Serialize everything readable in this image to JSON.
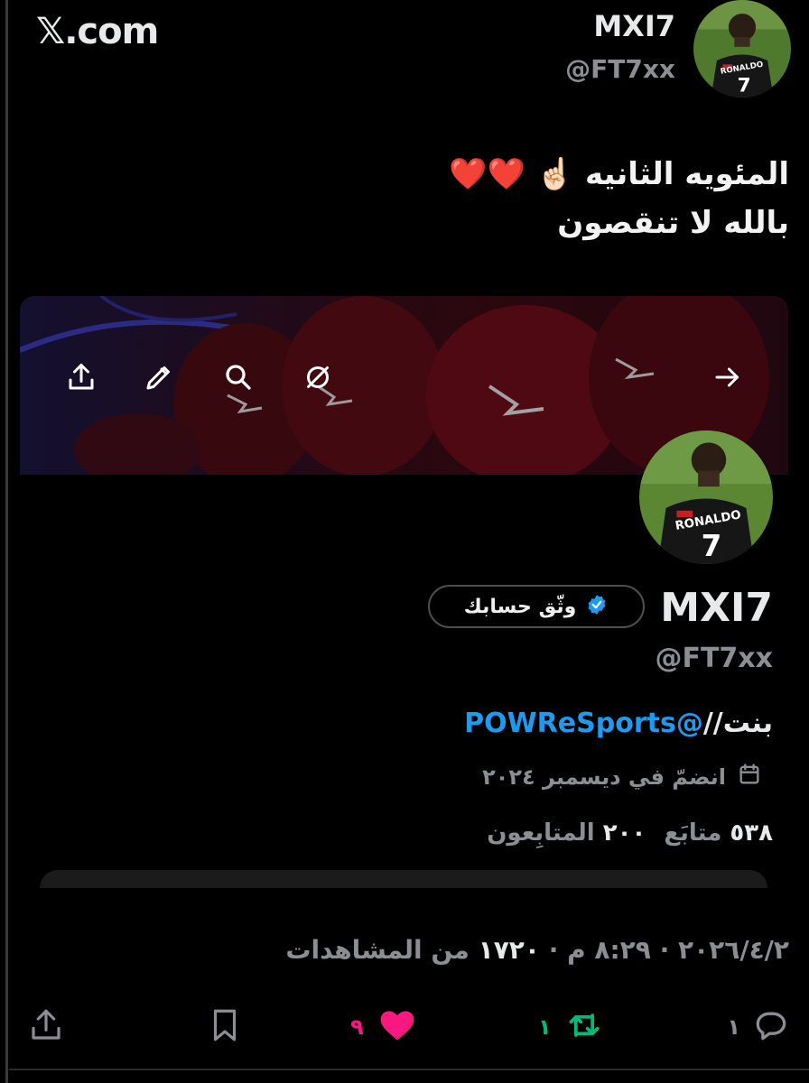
{
  "header": {
    "site_label": "𝕏.com",
    "author_name": "MXI7",
    "author_handle": "@FT7xx"
  },
  "tweet": {
    "line1": "المئويه الثانيه",
    "line1_emoji": "☝🏻",
    "line1_hearts": "❤️❤️",
    "line2": "بالله لا تنقصون"
  },
  "profile_card": {
    "name": "MXI7",
    "handle": "@FT7xx",
    "verify_label": "وثّق حسابك",
    "bio_prefix": "بنت//",
    "bio_link": "@POWReSports",
    "joined": "انضمّ في ديسمبر ٢٠٢٤",
    "following_count": "٥٣٨",
    "following_label": "متابَع",
    "followers_count": "٢٠٠",
    "followers_label": "المتابِعون",
    "jersey_text": "RONALDO",
    "jersey_number": "7"
  },
  "meta": {
    "date": "٢٠٢٦/٤/٢",
    "time": "٨:٢٩ م",
    "separator": "·",
    "views_count": "١٧٢٠",
    "views_label": "من المشاهدات"
  },
  "actions": {
    "reply_count": "١",
    "retweet_count": "١",
    "like_count": "٩"
  },
  "colors": {
    "background": "#000000",
    "link": "#1d9bf0",
    "like": "#f91880",
    "retweet": "#00ba7c",
    "muted": "#8b8f94",
    "verified": "#1d9bf0"
  },
  "icons": [
    "share-icon",
    "edit-icon",
    "search-icon",
    "no-filter-icon",
    "arrow-right-icon",
    "verified-badge-icon",
    "calendar-icon",
    "reply-icon",
    "retweet-icon",
    "heart-icon",
    "bookmark-icon"
  ]
}
